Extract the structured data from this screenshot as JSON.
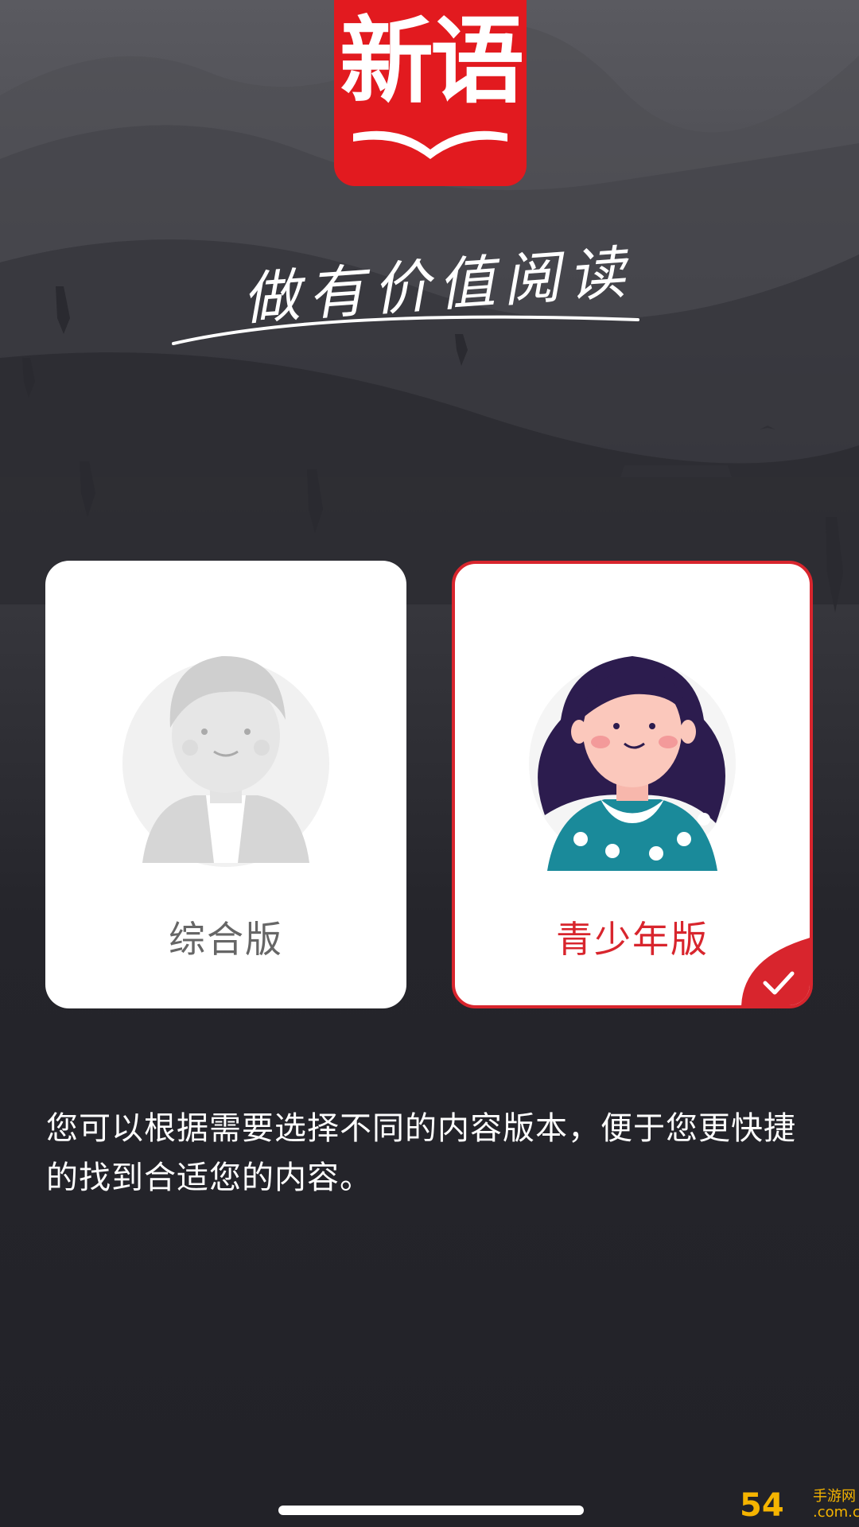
{
  "app": {
    "logo_text": "新语",
    "slogan": "做有价值阅读"
  },
  "versions": [
    {
      "label": "综合版",
      "selected": false
    },
    {
      "label": "青少年版",
      "selected": true
    }
  ],
  "description": "您可以根据需要选择不同的内容版本，便于您更快捷的找到合适您的内容。",
  "watermark": {
    "main": "54",
    "side_top": "手游网",
    "side_bottom": ".com.cn"
  },
  "colors": {
    "accent": "#d8252d",
    "brand_red": "#e21a1f",
    "background": "#222228"
  },
  "icons": [
    "check-icon",
    "boy-avatar-icon",
    "girl-avatar-icon"
  ]
}
